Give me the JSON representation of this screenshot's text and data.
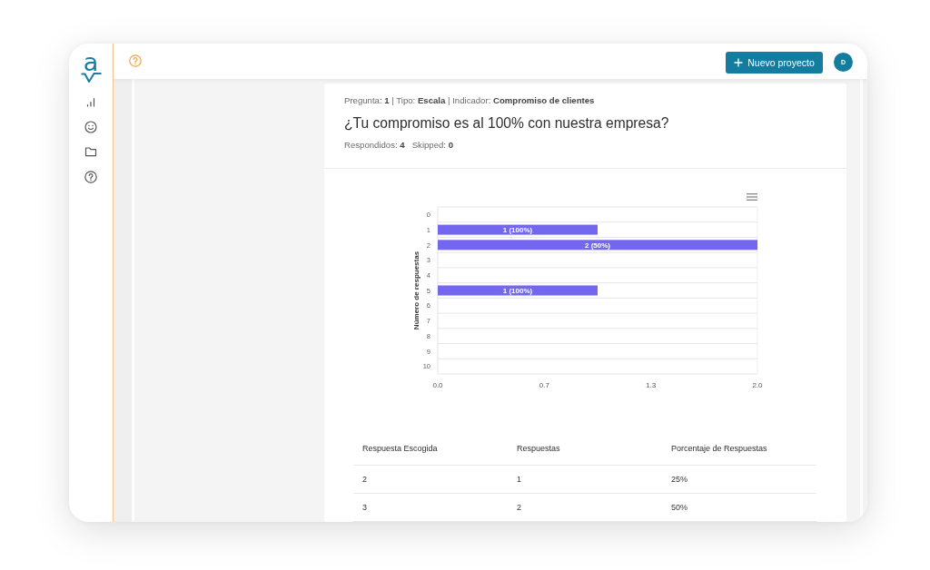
{
  "sidebar": {
    "logo": {
      "text": "a"
    }
  },
  "top_bar": {
    "new_project_button": {
      "label": "Nuevo proyecto"
    },
    "avatar": {
      "initial": "D"
    }
  },
  "question": {
    "meta": "Pregunta: **1** | Tipo: **Escala** | Indicador: **Compromiso de clientes**",
    "title": "¿Tu compromiso es al 100% con nuestra empresa?",
    "stats": [
      "Respondidos: **4**",
      "Skipped: **0**"
    ]
  },
  "chart": {
    "chart_data": {
      "type": "bar",
      "orientation": "horizontal",
      "ylabel": "Número de respuestas",
      "categories": [
        "0",
        "1",
        "2",
        "3",
        "4",
        "5",
        "6",
        "7",
        "8",
        "9",
        "10"
      ],
      "values": [
        0,
        1,
        2,
        0,
        0,
        1,
        0,
        0,
        0,
        0,
        0
      ],
      "xlim": [
        0,
        2
      ],
      "xticks": [
        {
          "value": 0,
          "label": "0.0"
        },
        {
          "value": 0.667,
          "label": "0.7"
        },
        {
          "value": 1.333,
          "label": "1.3"
        },
        {
          "value": 2,
          "label": "2.0"
        }
      ],
      "value_labels": [
        null,
        "1 (100%)",
        "2 (50%)",
        null,
        null,
        "1 (100%)",
        null,
        null,
        null,
        null,
        null
      ]
    }
  },
  "table": {
    "columns": [
      "Respuesta Escogida",
      "Respuestas",
      "Porcentaje de Respuestas"
    ],
    "rows": [
      [
        "2",
        "1",
        "25%"
      ],
      [
        "3",
        "2",
        "50%"
      ]
    ]
  }
}
